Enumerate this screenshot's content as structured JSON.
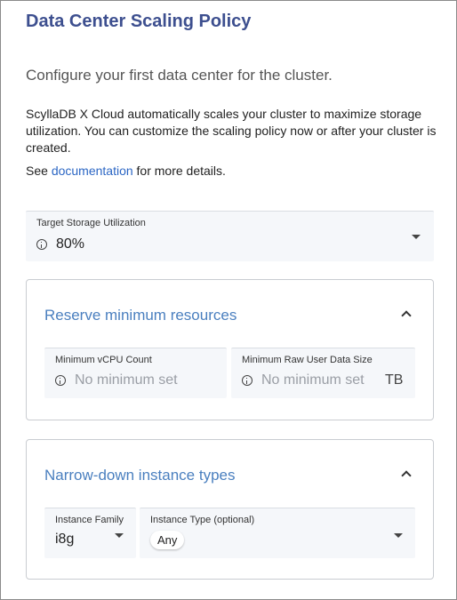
{
  "title": "Data Center Scaling Policy",
  "subtitle": "Configure your first data center for the cluster.",
  "description": "ScyllaDB X Cloud automatically scales your cluster to maximize storage utilization. You can customize the scaling policy now or after your cluster is created.",
  "see": {
    "prefix": "See ",
    "link": "documentation",
    "suffix": " for more details."
  },
  "target_storage": {
    "label": "Target Storage Utilization",
    "value": "80%"
  },
  "reserve": {
    "title": "Reserve minimum resources",
    "vcpu": {
      "label": "Minimum vCPU Count",
      "placeholder": "No minimum set"
    },
    "storage": {
      "label": "Minimum Raw User Data Size",
      "placeholder": "No minimum set",
      "unit": "TB"
    }
  },
  "narrow": {
    "title": "Narrow-down instance types",
    "family": {
      "label": "Instance Family",
      "value": "i8g"
    },
    "type": {
      "label": "Instance Type (optional)",
      "chip": "Any"
    }
  }
}
